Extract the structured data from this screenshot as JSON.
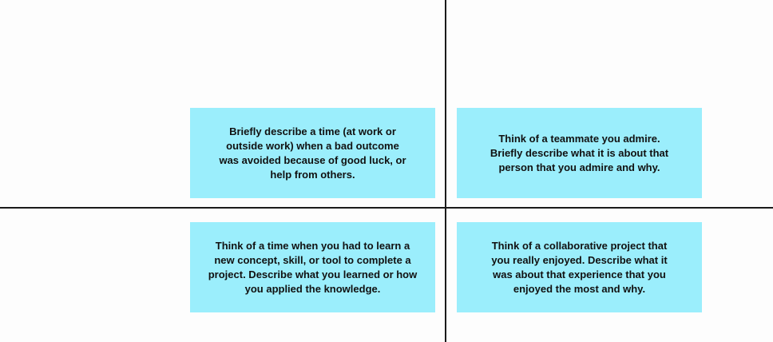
{
  "colors": {
    "sticky_note": "#9beefc",
    "divider": "#1a1a1a",
    "background": "#fdfdfd"
  },
  "notes": [
    {
      "text": "Briefly describe a time (at work or\noutside work) when a bad outcome\nwas avoided because of good luck, or\nhelp from others."
    },
    {
      "text": "Think of a teammate you admire.\nBriefly describe what it is about that\nperson that you admire and why."
    },
    {
      "text": "Think of a time when you had to learn a\nnew concept, skill, or tool to complete a\nproject. Describe what you learned or how\nyou applied the knowledge."
    },
    {
      "text": "Think of a collaborative project that\nyou really enjoyed.  Describe what it\nwas about that experience that you\nenjoyed the most and why."
    }
  ]
}
